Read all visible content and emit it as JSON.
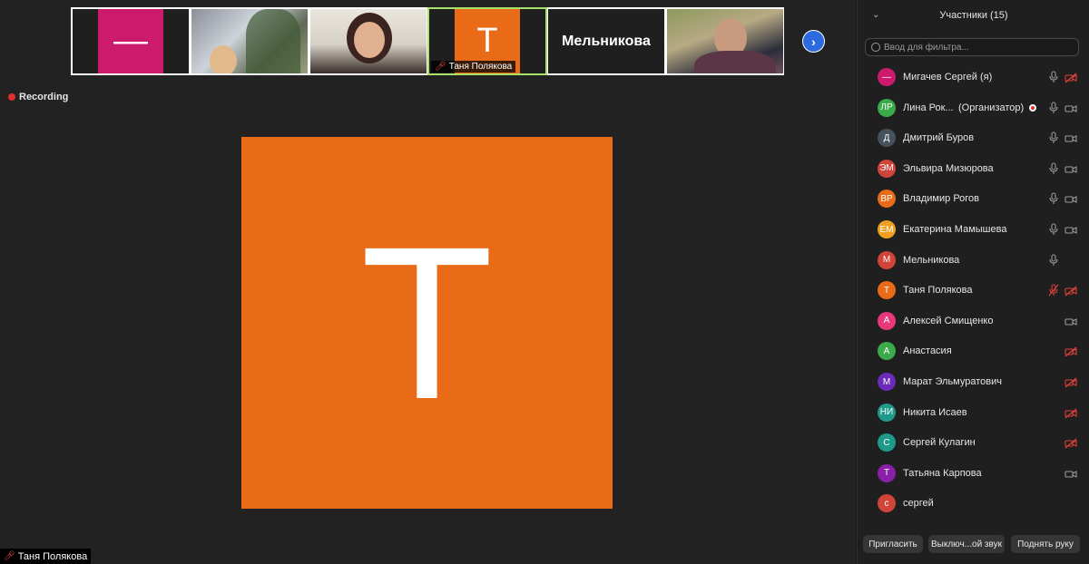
{
  "thumbnails": [
    {
      "type": "avatar",
      "letter": "—",
      "color": "#cc1a6d",
      "label": ""
    },
    {
      "type": "photo",
      "label": ""
    },
    {
      "type": "photo",
      "label": ""
    },
    {
      "type": "avatar",
      "letter": "T",
      "color": "#e96b17",
      "label": "Таня Полякова",
      "active": true
    },
    {
      "type": "name",
      "label": "Мельникова"
    },
    {
      "type": "photo",
      "label": ""
    }
  ],
  "recording_label": "Recording",
  "main_video": {
    "letter": "T",
    "color": "#e96b17",
    "name": "Таня Полякова"
  },
  "panel": {
    "title": "Участники (15)",
    "filter_placeholder": "Ввод для фильтра...",
    "participants": [
      {
        "initials": "—",
        "name": "Мигачев Сергей (я)",
        "color": "#cc1a6d",
        "mic": "on",
        "cam": "off"
      },
      {
        "initials": "ЛР",
        "name": "Лина Рок...",
        "role": "(Организатор)",
        "recording": true,
        "color": "#3aaa4a",
        "mic": "on",
        "cam": "on"
      },
      {
        "initials": "Д",
        "name": "Дмитрий Буров",
        "color": "#44525e",
        "mic": "on",
        "cam": "on"
      },
      {
        "initials": "ЭМ",
        "name": "Эльвира Мизюрова",
        "color": "#d1443a",
        "mic": "on",
        "cam": "on"
      },
      {
        "initials": "ВР",
        "name": "Владимир Рогов",
        "color": "#e96b17",
        "mic": "on",
        "cam": "on"
      },
      {
        "initials": "ЕМ",
        "name": "Екатерина Мамышева",
        "color": "#f0a020",
        "mic": "on",
        "cam": "on"
      },
      {
        "initials": "М",
        "name": "Мельникова",
        "color": "#d1443a",
        "mic": "on",
        "cam": "none"
      },
      {
        "initials": "Т",
        "name": "Таня Полякова",
        "color": "#e96b17",
        "mic": "off",
        "cam": "off"
      },
      {
        "initials": "А",
        "name": "Алексей Смищенко",
        "color": "#e8387a",
        "mic": "none",
        "cam": "on"
      },
      {
        "initials": "А",
        "name": "Анастасия",
        "color": "#3aaa4a",
        "mic": "none",
        "cam": "off"
      },
      {
        "initials": "М",
        "name": "Марат Эльмуратович",
        "color": "#6a2bb8",
        "mic": "none",
        "cam": "off"
      },
      {
        "initials": "НИ",
        "name": "Никита Исаев",
        "color": "#1f9a8a",
        "mic": "none",
        "cam": "off"
      },
      {
        "initials": "С",
        "name": "Сергей Кулагин",
        "color": "#1f9a8a",
        "mic": "none",
        "cam": "off"
      },
      {
        "initials": "Т",
        "name": "Татьяна Карпова",
        "color": "#8a1fa8",
        "mic": "none",
        "cam": "on"
      },
      {
        "initials": "с",
        "name": "сергей",
        "color": "#d1443a",
        "mic": "none",
        "cam": "none"
      }
    ],
    "buttons": {
      "invite": "Пригласить",
      "mute_all": "Выключ...ой звук",
      "raise_hand": "Поднять руку"
    }
  }
}
